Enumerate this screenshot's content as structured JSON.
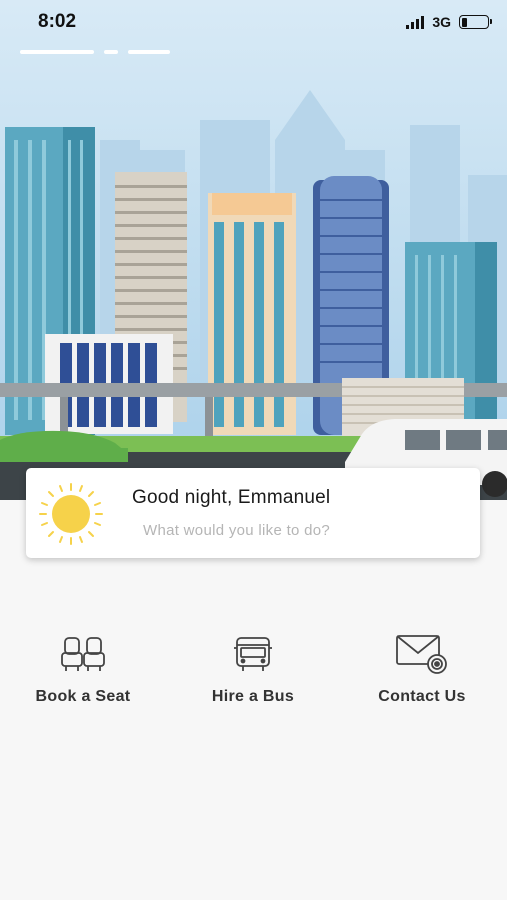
{
  "status_bar": {
    "time": "8:02",
    "network": "3G",
    "battery_level": 0.22,
    "signal_bars": 4
  },
  "pager": {
    "pages": 3,
    "active_index": 0
  },
  "greeting": {
    "title": "Good night, Emmanuel",
    "subtitle": "What would you like to do?",
    "icon": "sun-icon"
  },
  "actions": [
    {
      "label": "Book a Seat",
      "icon": "seat-icon"
    },
    {
      "label": "Hire a Bus",
      "icon": "bus-icon"
    },
    {
      "label": "Contact Us",
      "icon": "mail-icon"
    }
  ],
  "colors": {
    "background": "#f7f7f7",
    "sky": "#bfdcef",
    "sun": "#f6d24a",
    "text_primary": "#1a1a1a",
    "text_secondary": "#b5b5b5"
  }
}
